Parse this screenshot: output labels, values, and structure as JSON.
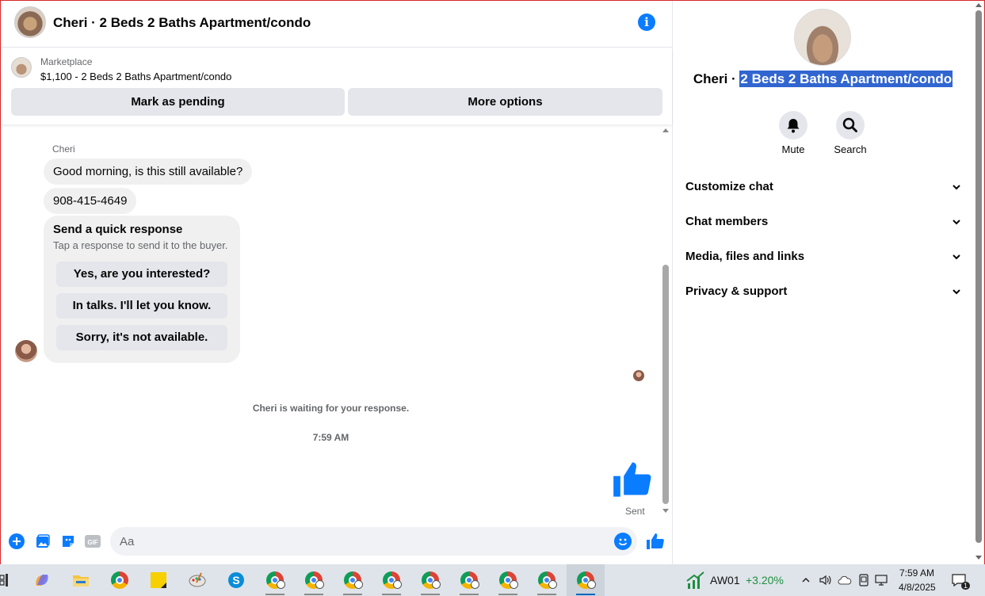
{
  "header": {
    "title": "Cheri · 2 Beds 2 Baths Apartment/condo"
  },
  "listing": {
    "label": "Marketplace",
    "price_title": "$1,100 - 2 Beds 2 Baths Apartment/condo",
    "mark_pending": "Mark as pending",
    "more_options": "More options"
  },
  "messages": {
    "sender_name": "Cheri",
    "items": [
      "Good morning, is this still available?",
      "908-415-4649"
    ],
    "quick_response": {
      "title": "Send a quick response",
      "subtitle": "Tap a response to send it to the buyer.",
      "options": [
        "Yes, are you interested?",
        "In talks. I'll let you know.",
        "Sorry, it's not available."
      ]
    },
    "waiting_text": "Cheri is waiting for your response.",
    "timestamp": "7:59 AM",
    "sent_label": "Sent"
  },
  "composer": {
    "placeholder": "Aa",
    "gif_label": "GIF"
  },
  "profile": {
    "name_prefix": "Cheri · ",
    "name_selected": "2 Beds 2 Baths Apartment/condo",
    "actions": {
      "mute": "Mute",
      "search": "Search"
    },
    "menu": [
      "Customize chat",
      "Chat members",
      "Media, files and links",
      "Privacy & support"
    ]
  },
  "taskbar": {
    "stock_symbol": "AW01",
    "stock_change": "+3.20%",
    "time": "7:59 AM",
    "date": "4/8/2025",
    "notification_count": "1"
  },
  "colors": {
    "messenger_blue": "#0a7cff",
    "selection": "#3166d0",
    "stock_green": "#1e8e3e"
  }
}
